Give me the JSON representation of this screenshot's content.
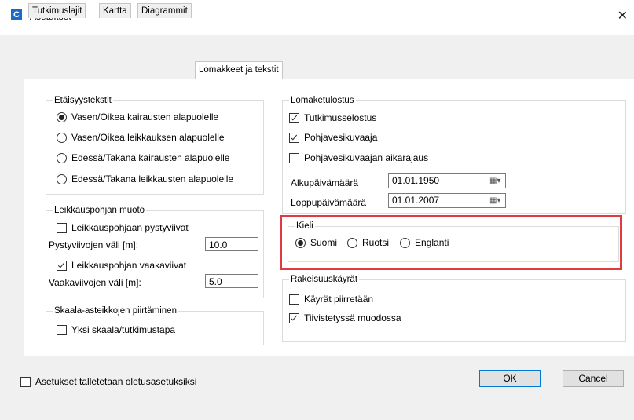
{
  "window": {
    "title": "Asetukset",
    "app_icon": "C"
  },
  "tabs": [
    {
      "label": "Tutkimuslajit"
    },
    {
      "label": "Kartta"
    },
    {
      "label": "Diagrammit"
    },
    {
      "label": "Lomakkeet ja tekstit"
    }
  ],
  "etaisyys": {
    "title": "Etäisyystekstit",
    "options": [
      {
        "label": "Vasen/Oikea kairausten alapuolelle",
        "selected": true
      },
      {
        "label": "Vasen/Oikea leikkauksen alapuolelle",
        "selected": false
      },
      {
        "label": "Edessä/Takana kairausten alapuolelle",
        "selected": false
      },
      {
        "label": "Edessä/Takana leikkausten alapuolelle",
        "selected": false
      }
    ]
  },
  "leikkaus": {
    "title": "Leikkauspohjan muoto",
    "pysty_check": "Leikkauspohjaan pystyviivat",
    "pysty_checked": false,
    "pysty_label": "Pystyviivojen väli [m]:",
    "pysty_value": "10.0",
    "vaaka_check": "Leikkauspohjan vaakaviivat",
    "vaaka_checked": true,
    "vaaka_label": "Vaakaviivojen väli [m]:",
    "vaaka_value": "5.0"
  },
  "skaala": {
    "title": "Skaala-asteikkojen piirtäminen",
    "check": "Yksi skaala/tutkimustapa",
    "checked": false
  },
  "lomake": {
    "title": "Lomaketulostus",
    "checks": [
      {
        "label": "Tutkimusselostus",
        "checked": true
      },
      {
        "label": "Pohjavesikuvaaja",
        "checked": true
      },
      {
        "label": "Pohjavesikuvaajan aikarajaus",
        "checked": false
      }
    ],
    "alku_label": "Alkupäivämäärä",
    "alku_value": "01.01.1950",
    "loppu_label": "Loppupäivämäärä",
    "loppu_value": "01.01.2007"
  },
  "kieli": {
    "title": "Kieli",
    "options": [
      {
        "label": "Suomi",
        "selected": true
      },
      {
        "label": "Ruotsi",
        "selected": false
      },
      {
        "label": "Englanti",
        "selected": false
      }
    ]
  },
  "rakeisuus": {
    "title": "Rakeisuuskäyrät",
    "checks": [
      {
        "label": "Käyrät piirretään",
        "checked": false
      },
      {
        "label": "Tiivistetyssä muodossa",
        "checked": true
      }
    ]
  },
  "footer": {
    "save_default": "Asetukset talletetaan oletusasetuksiksi",
    "save_default_checked": false,
    "ok": "OK",
    "cancel": "Cancel"
  },
  "colors": {
    "highlight": "#e03a3e",
    "accent": "#0078d7"
  }
}
